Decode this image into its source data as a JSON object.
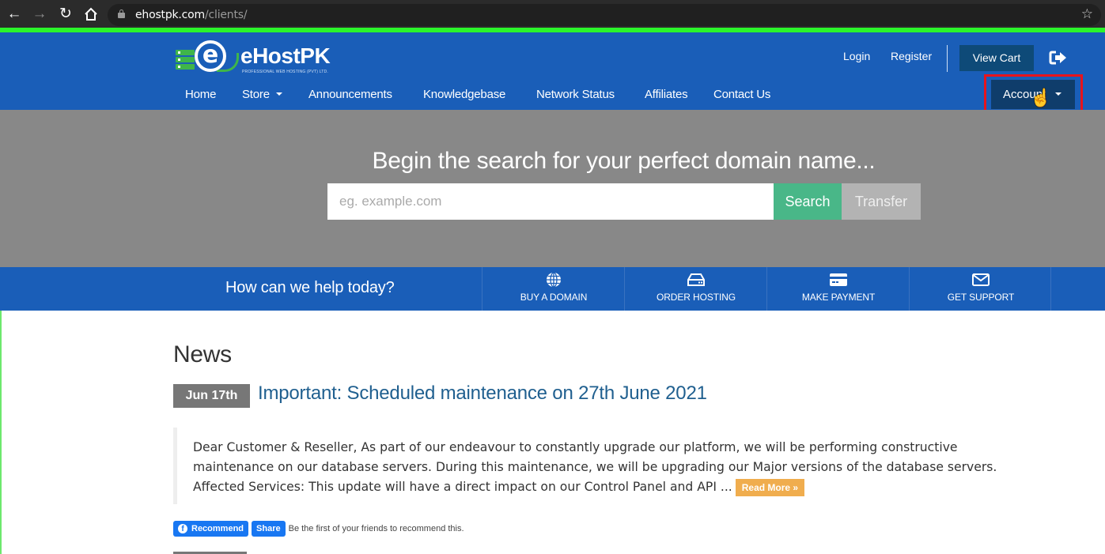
{
  "browser": {
    "url_domain": "ehostpk.com",
    "url_path": "/clients/",
    "icons": {
      "back": "arrow-left-icon",
      "forward": "arrow-right-icon",
      "reload": "reload-icon",
      "home": "home-icon",
      "lock": "lock-icon",
      "bookmark": "star-icon"
    }
  },
  "header": {
    "logo": {
      "brand": "eHostPK",
      "tagline": "PROFESSIONAL WEB HOSTING (PVT) LTD."
    },
    "top_links": [
      "Login",
      "Register"
    ],
    "view_cart_label": "View Cart",
    "logout_icon": "sign-out-icon",
    "nav": [
      {
        "label": "Home",
        "dropdown": false
      },
      {
        "label": "Store",
        "dropdown": true
      },
      {
        "label": "Announcements",
        "dropdown": false
      },
      {
        "label": "Knowledgebase",
        "dropdown": false
      },
      {
        "label": "Network Status",
        "dropdown": false
      },
      {
        "label": "Affiliates",
        "dropdown": false
      },
      {
        "label": "Contact Us",
        "dropdown": false
      }
    ],
    "account_label": "Account"
  },
  "hero": {
    "title": "Begin the search for your perfect domain name...",
    "input_placeholder": "eg. example.com",
    "input_value": "",
    "search_label": "Search",
    "transfer_label": "Transfer"
  },
  "helpbar": {
    "question": "How can we help today?",
    "items": [
      {
        "label": "BUY A DOMAIN",
        "icon": "globe-icon"
      },
      {
        "label": "ORDER HOSTING",
        "icon": "hdd-icon"
      },
      {
        "label": "MAKE PAYMENT",
        "icon": "credit-card-icon"
      },
      {
        "label": "GET SUPPORT",
        "icon": "envelope-icon"
      }
    ]
  },
  "news": {
    "heading": "News",
    "items": [
      {
        "date": "Jun 17th",
        "title": "Important: Scheduled maintenance on 27th June 2021",
        "lines": [
          "Dear Customer & Reseller, As part of our endeavour to constantly upgrade our platform, we will be performing constructive",
          "maintenance on our database servers. During this maintenance, we will be upgrading our Major versions of the database servers.",
          "Affected Services:  This update will have a direct impact on our Control Panel and API ..."
        ],
        "read_more": "Read More »"
      }
    ],
    "facebook": {
      "recommend": "Recommend",
      "share": "Share",
      "text": "Be the first of your friends to recommend this."
    }
  },
  "colors": {
    "header_blue": "#1a5eb8",
    "hero_gray": "#888888",
    "search_green": "#49b788",
    "transfer_gray": "#b3b3b3",
    "account_navy": "#0f3d6b",
    "view_cart_navy": "#0e4a78",
    "highlight_red": "#e8141c",
    "read_more_orange": "#f0ad4e",
    "link_blue": "#1f5f8f",
    "facebook_blue": "#1877f2"
  }
}
